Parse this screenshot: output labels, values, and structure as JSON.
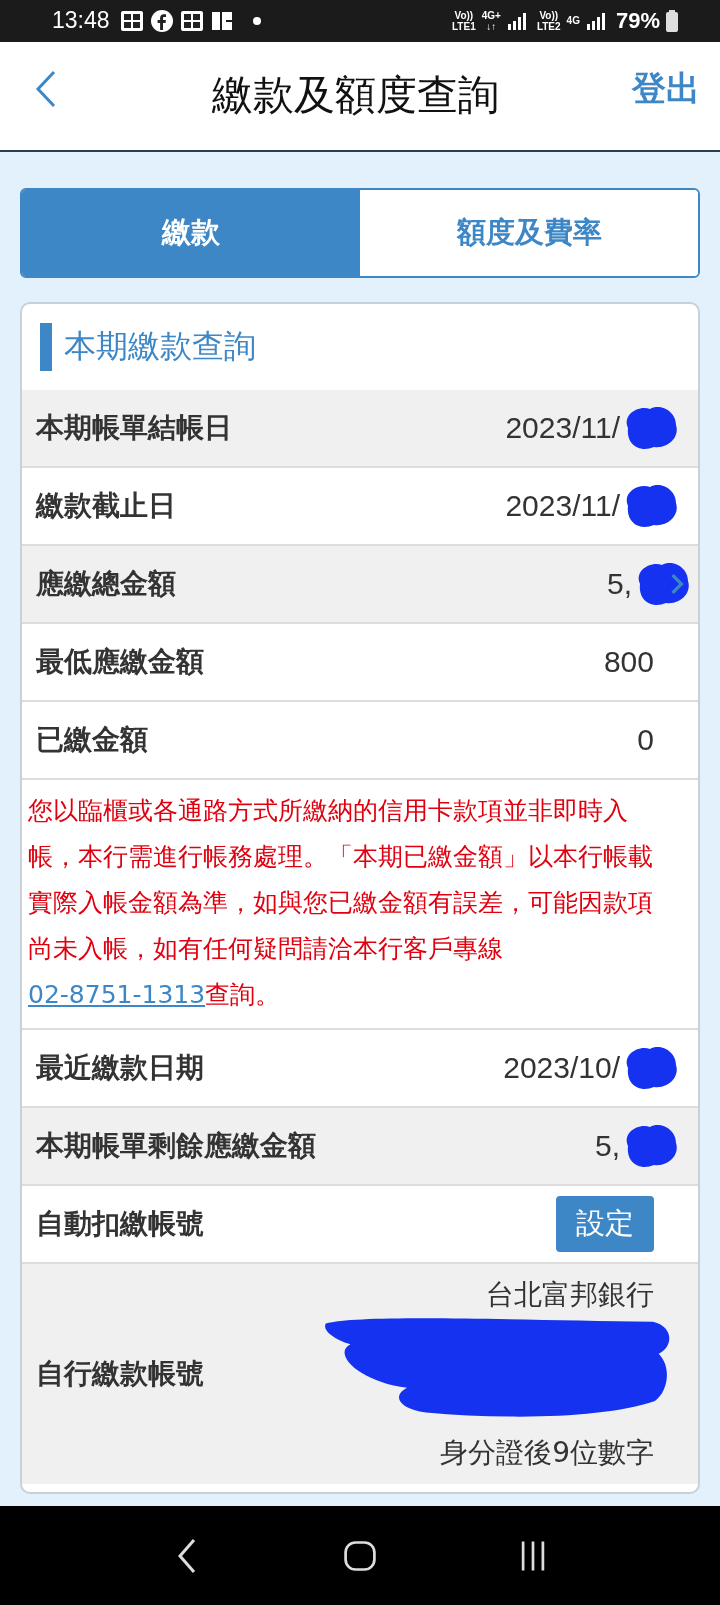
{
  "status_bar": {
    "time": "13:48",
    "network": [
      {
        "top": "Vo))",
        "bottom": "LTE1"
      },
      {
        "top": "4G+",
        "bottom": "↓↑"
      },
      {
        "top": "Vo))",
        "bottom": "LTE2"
      },
      {
        "top": "4G"
      }
    ],
    "battery": "79%"
  },
  "header": {
    "title": "繳款及額度查詢",
    "logout": "登出"
  },
  "tabs": [
    {
      "label": "繳款",
      "selected": true
    },
    {
      "label": "額度及費率",
      "selected": false
    }
  ],
  "section_title": "本期繳款查詢",
  "rows": [
    {
      "kind": "value",
      "label": "本期帳單結帳日",
      "value": "2023/11/",
      "redacted": true,
      "shaded": true
    },
    {
      "kind": "value",
      "label": "繳款截止日",
      "value": "2023/11/",
      "redacted": true,
      "shaded": false
    },
    {
      "kind": "link",
      "label": "應繳總金額",
      "value": "5,",
      "redacted": true,
      "shaded": true
    },
    {
      "kind": "value",
      "label": "最低應繳金額",
      "value": "800",
      "redacted": false,
      "shaded": false
    },
    {
      "kind": "value",
      "label": "已繳金額",
      "value": "0",
      "redacted": false,
      "shaded": false
    },
    {
      "kind": "notice",
      "before": "您以臨櫃或各通路方式所繳納的信用卡款項並非即時入帳，本行需進行帳務處理。「本期已繳金額」以本行帳載實際入帳金額為準，如與您已繳金額有誤差，可能因款項尚未入帳，如有任何疑問請洽本行客戶專線",
      "link": "02-8751-1313",
      "after": "查詢。"
    },
    {
      "kind": "value",
      "label": "最近繳款日期",
      "value": "2023/10/",
      "redacted": true,
      "shaded": false
    },
    {
      "kind": "value",
      "label": "本期帳單剩餘應繳金額",
      "value": "5,",
      "redacted": true,
      "shaded": true
    },
    {
      "kind": "button",
      "label": "自動扣繳帳號",
      "button": "設定",
      "shaded": false
    },
    {
      "kind": "multiline",
      "label": "自行繳款帳號",
      "lines": [
        "台北富邦銀行",
        "身分證後9位數字"
      ],
      "redacted": true,
      "shaded": true
    }
  ]
}
